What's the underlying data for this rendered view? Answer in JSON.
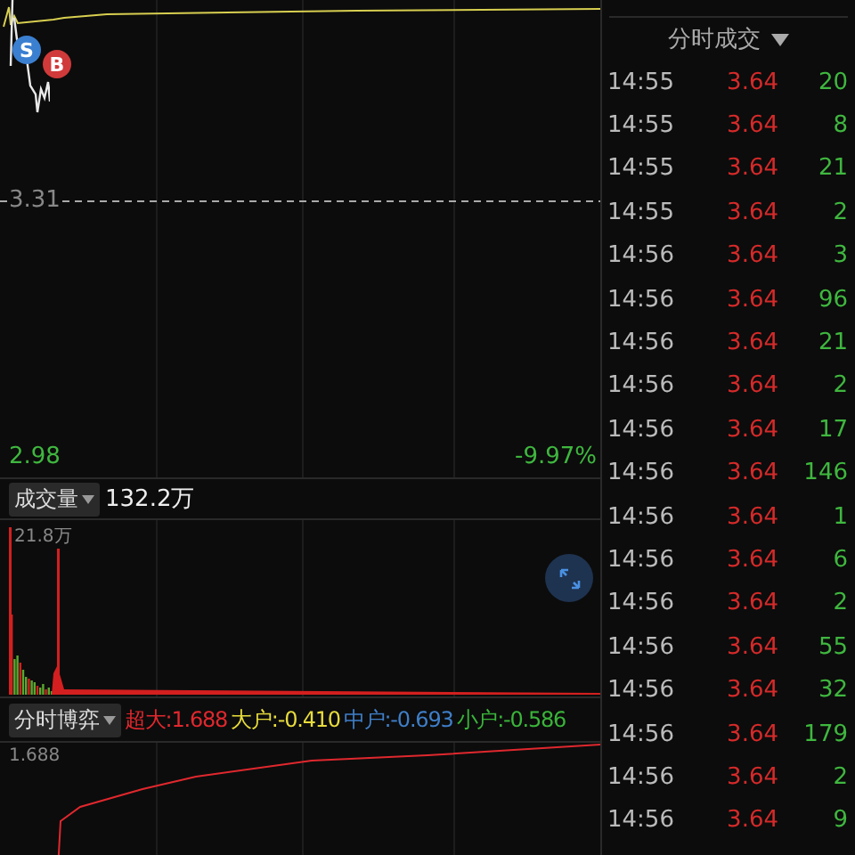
{
  "price_chart": {
    "markers": [
      {
        "kind": "sell",
        "label": "S"
      },
      {
        "kind": "buy",
        "label": "B"
      }
    ],
    "mid_price": "3.31",
    "low_price": "2.98",
    "low_change": "-9.97%"
  },
  "volume": {
    "selector": "成交量",
    "total": "132.2万",
    "max_label": "21.8万"
  },
  "flow": {
    "selector": "分时博弈",
    "items": [
      {
        "label": "超大:1.688",
        "color": "#e0282e"
      },
      {
        "label": "大户:-0.410",
        "color": "#e8dc3c"
      },
      {
        "label": "中户:-0.693",
        "color": "#3f7fc9"
      },
      {
        "label": "小户:-0.586",
        "color": "#3ab53a"
      }
    ],
    "max_label": "1.688"
  },
  "trades": {
    "header": "分时成交",
    "rows": [
      {
        "time": "14:55",
        "price": "3.64",
        "volume": "20"
      },
      {
        "time": "14:55",
        "price": "3.64",
        "volume": "8"
      },
      {
        "time": "14:55",
        "price": "3.64",
        "volume": "21"
      },
      {
        "time": "14:55",
        "price": "3.64",
        "volume": "2"
      },
      {
        "time": "14:56",
        "price": "3.64",
        "volume": "3"
      },
      {
        "time": "14:56",
        "price": "3.64",
        "volume": "96"
      },
      {
        "time": "14:56",
        "price": "3.64",
        "volume": "21"
      },
      {
        "time": "14:56",
        "price": "3.64",
        "volume": "2"
      },
      {
        "time": "14:56",
        "price": "3.64",
        "volume": "17"
      },
      {
        "time": "14:56",
        "price": "3.64",
        "volume": "146"
      },
      {
        "time": "14:56",
        "price": "3.64",
        "volume": "1"
      },
      {
        "time": "14:56",
        "price": "3.64",
        "volume": "6"
      },
      {
        "time": "14:56",
        "price": "3.64",
        "volume": "2"
      },
      {
        "time": "14:56",
        "price": "3.64",
        "volume": "55"
      },
      {
        "time": "14:56",
        "price": "3.64",
        "volume": "32"
      },
      {
        "time": "14:56",
        "price": "3.64",
        "volume": "179"
      },
      {
        "time": "14:56",
        "price": "3.64",
        "volume": "2"
      },
      {
        "time": "14:56",
        "price": "3.64",
        "volume": "9"
      }
    ]
  }
}
